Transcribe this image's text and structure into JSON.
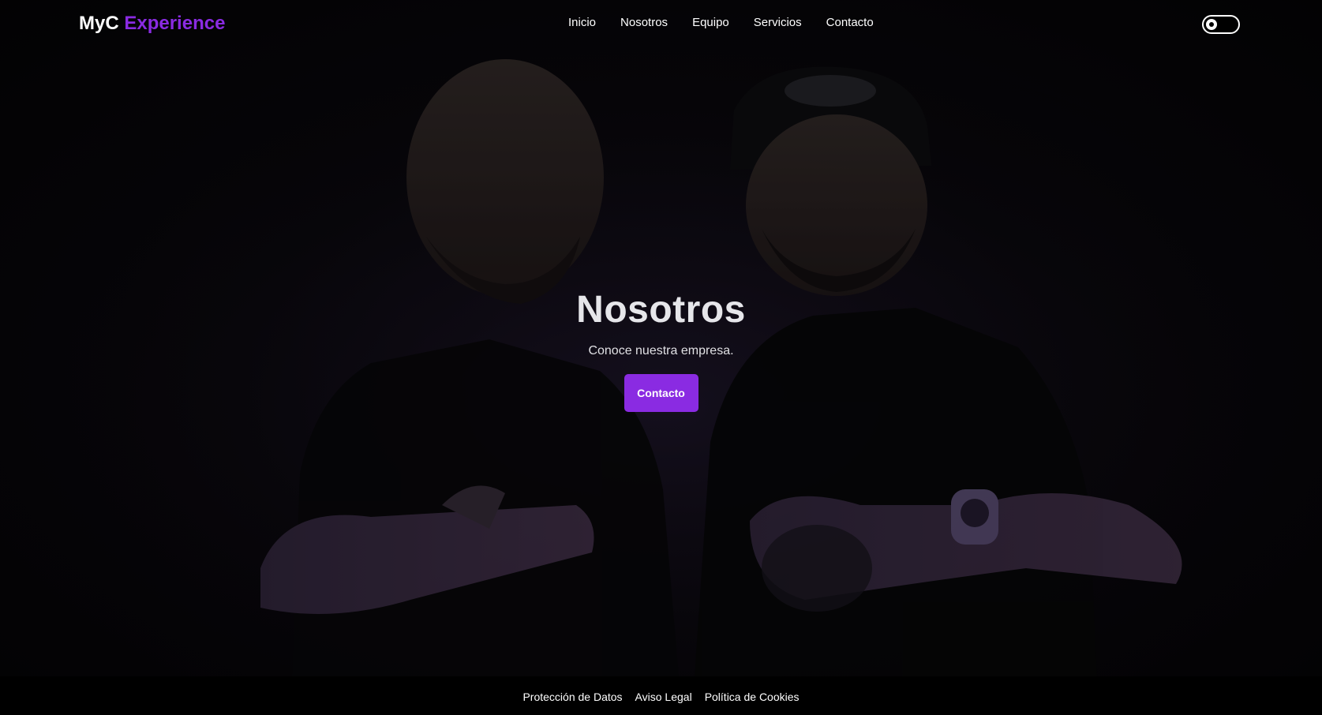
{
  "brand": {
    "primary": "MyC",
    "accent": "Experience",
    "accent_color": "#8a2be2"
  },
  "nav": {
    "items": [
      {
        "label": "Inicio"
      },
      {
        "label": "Nosotros"
      },
      {
        "label": "Equipo"
      },
      {
        "label": "Servicios"
      },
      {
        "label": "Contacto"
      }
    ]
  },
  "theme_toggle": {
    "icon": "gear-icon"
  },
  "hero": {
    "title": "Nosotros",
    "subtitle": "Conoce nuestra empresa.",
    "button_label": "Contacto",
    "button_color": "#8a2be2",
    "background": "hero-photo"
  },
  "footer": {
    "links": [
      {
        "label": "Protección de Datos"
      },
      {
        "label": "Aviso Legal"
      },
      {
        "label": "Política de Cookies"
      }
    ]
  }
}
